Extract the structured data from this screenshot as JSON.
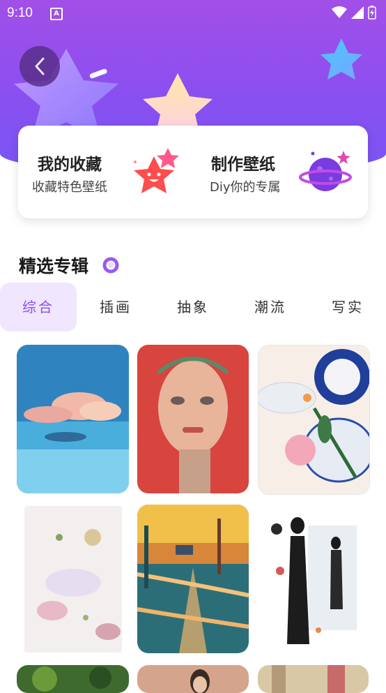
{
  "status": {
    "time": "9:10",
    "indicator": "A"
  },
  "header": {
    "back_icon": "chevron-left-icon"
  },
  "cards": [
    {
      "title": "我的收藏",
      "subtitle": "收藏特色壁纸",
      "icon": "star-face-icon"
    },
    {
      "title": "制作壁纸",
      "subtitle": "Diy你的专属",
      "icon": "planet-icon"
    }
  ],
  "section": {
    "title": "精选专辑"
  },
  "tabs": [
    {
      "label": "综合",
      "active": true
    },
    {
      "label": "插画",
      "active": false
    },
    {
      "label": "抽象",
      "active": false
    },
    {
      "label": "潮流",
      "active": false
    },
    {
      "label": "写实",
      "active": false
    }
  ],
  "colors": {
    "accent": "#8a4ff0",
    "header_top": "#a24fe7",
    "tab_active_bg": "#f0e6fd"
  }
}
